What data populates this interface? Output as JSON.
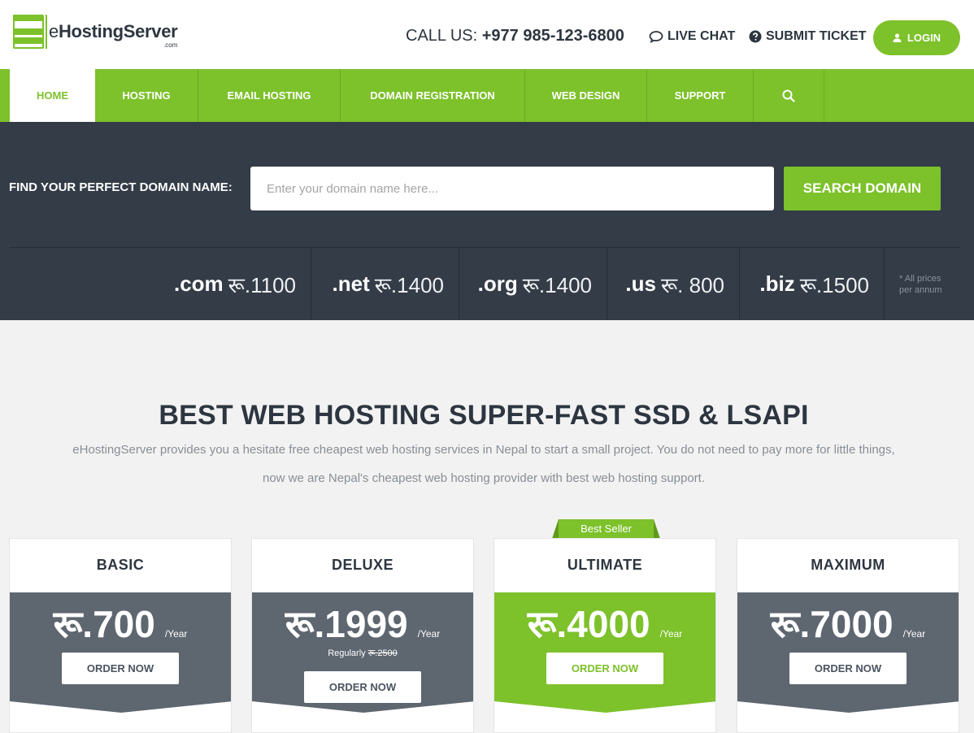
{
  "brand": {
    "name_prefix": "e",
    "name_main": "HostingServer",
    "tld": ".com",
    "accent": "#7dc12b",
    "dark": "#333c47"
  },
  "header": {
    "call_label": "CALL US:",
    "phone": "+977 985-123-6800",
    "live_chat": "LIVE CHAT",
    "submit_ticket": "SUBMIT TICKET",
    "login": "LOGIN"
  },
  "nav": {
    "items": [
      {
        "label": "HOME",
        "active": true
      },
      {
        "label": "HOSTING"
      },
      {
        "label": "EMAIL HOSTING"
      },
      {
        "label": "DOMAIN REGISTRATION"
      },
      {
        "label": "WEB DESIGN"
      },
      {
        "label": "SUPPORT"
      }
    ],
    "search_icon": "search-icon"
  },
  "domain_search": {
    "label": "FIND YOUR PERFECT DOMAIN NAME:",
    "placeholder": "Enter your domain name here...",
    "button": "SEARCH DOMAIN",
    "tlds": [
      {
        "ext": ".com",
        "price": "रू.1100"
      },
      {
        "ext": ".net",
        "price": "रू.1400"
      },
      {
        "ext": ".org",
        "price": "रू.1400"
      },
      {
        "ext": ".us",
        "price": "रू. 800"
      },
      {
        "ext": ".biz",
        "price": "रू.1500"
      }
    ],
    "note_line1": "* All prices",
    "note_line2": "per annum"
  },
  "hero": {
    "title": "BEST WEB HOSTING SUPER-FAST SSD & LSAPI",
    "desc_line1": "eHostingServer provides you a hesitate free cheapest web hosting services in Nepal to start a small project. You do not need to pay more for little things,",
    "desc_line2": "now we are Nepal's cheapest web hosting provider with best web hosting support."
  },
  "plans": [
    {
      "name": "BASIC",
      "price": "रू.700",
      "per": "/Year",
      "order": "ORDER NOW",
      "highlight": false
    },
    {
      "name": "DELUXE",
      "price": "रू.1999",
      "per": "/Year",
      "regular_label": "Regularly",
      "regular_price": "रू.2500",
      "order": "ORDER NOW",
      "highlight": false
    },
    {
      "name": "ULTIMATE",
      "price": "रू.4000",
      "per": "/Year",
      "order": "ORDER NOW",
      "highlight": true,
      "badge": "Best Seller"
    },
    {
      "name": "MAXIMUM",
      "price": "रू.7000",
      "per": "/Year",
      "order": "ORDER NOW",
      "highlight": false
    }
  ]
}
